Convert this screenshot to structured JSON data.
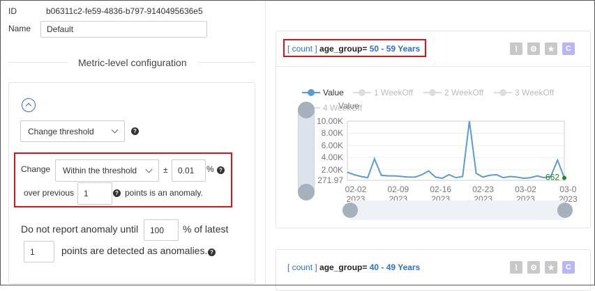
{
  "form": {
    "id_label": "ID",
    "id_value": "b06311c2-fe59-4836-b797-9140495636e5",
    "name_label": "Name",
    "name_value": "Default",
    "section_title": "Metric-level configuration",
    "rule_type": "Change threshold",
    "change_label": "Change",
    "change_mode": "Within the threshold",
    "plus_minus": "±",
    "threshold_value": "0.01",
    "percent": "%",
    "over_previous_label": "over previous",
    "points_value": "1",
    "points_suffix": "points is an anomaly.",
    "no_report_prefix": "Do not report anomaly until",
    "no_report_pct": "100",
    "no_report_pct_suffix": "% of latest",
    "no_report_points": "1",
    "no_report_suffix": "points are detected as anomalies."
  },
  "cards": [
    {
      "count_tag": "[ count ]",
      "dimension_key": "age_group=",
      "dimension_value": "50 - 59 Years"
    },
    {
      "count_tag": "[ count ]",
      "dimension_key": "age_group=",
      "dimension_value": "40 - 49 Years"
    }
  ],
  "toolbar": {
    "star": "★",
    "c": "C"
  },
  "legend": [
    "Value",
    "1 WeekOff",
    "2 WeekOff",
    "3 WeekOff",
    "4 WeekOff"
  ],
  "colors": {
    "accent": "#2b6fd6",
    "line": "#5b9bd5",
    "highlight": "#e0101a",
    "anomaly": "#1a8a1a"
  },
  "chart_data": {
    "type": "line",
    "ylabel": "Value",
    "y_ticks": [
      "10.00K",
      "8.00K",
      "6.00K",
      "4.00K",
      "2.00K",
      "271.97"
    ],
    "ylim": [
      271.97,
      10000
    ],
    "x_ticks": [
      "02-02\n2023",
      "02-09\n2023",
      "02-16\n2023",
      "02-23\n2023",
      "03-02\n2023",
      "03-0\n2023"
    ],
    "series": [
      {
        "name": "Value",
        "values": [
          1600,
          1200,
          900,
          700,
          3800,
          1100,
          1000,
          1000,
          900,
          800,
          800,
          1200,
          1800,
          800,
          600,
          1200,
          700,
          900,
          10000,
          1400,
          800,
          1100,
          1200,
          700,
          900,
          800,
          600,
          700,
          1000,
          700,
          900,
          3600,
          662
        ]
      }
    ],
    "annotation": "662"
  }
}
